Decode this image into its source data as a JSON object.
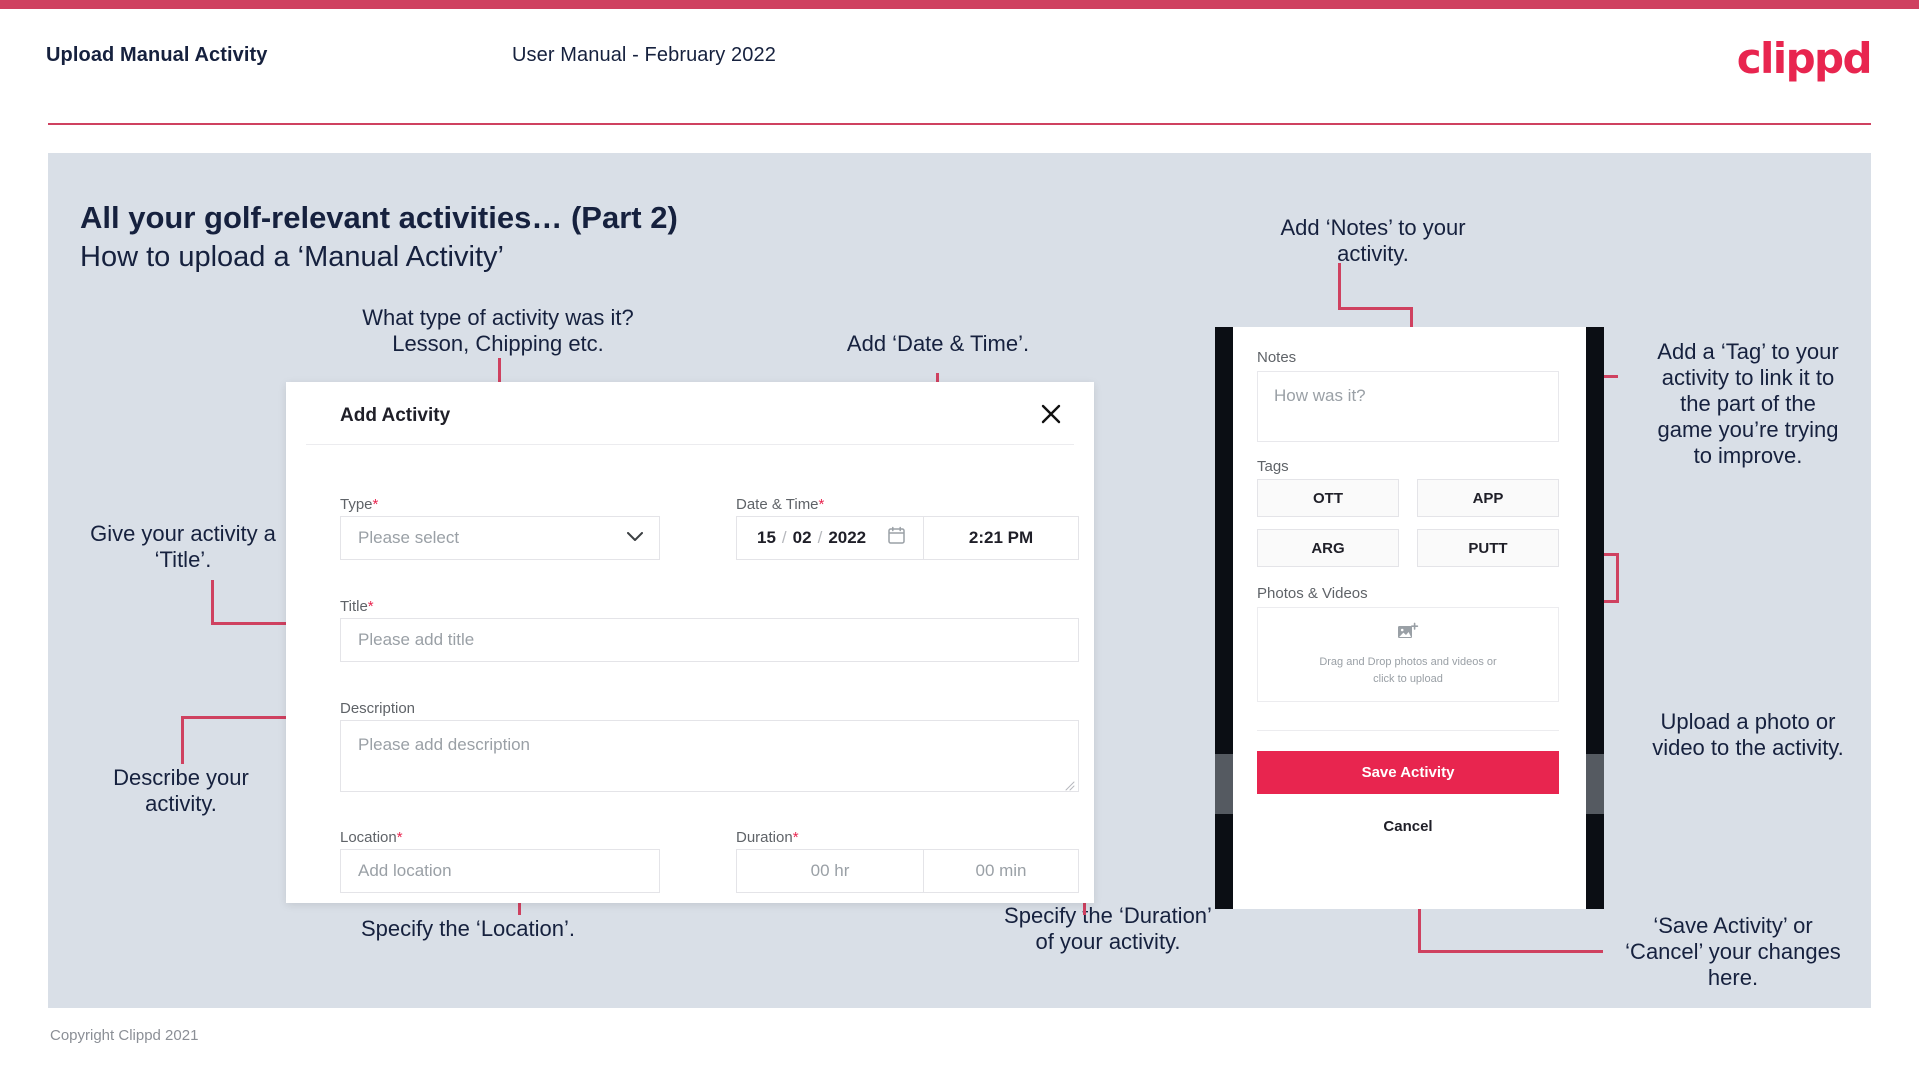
{
  "header": {
    "title": "Upload Manual Activity",
    "subtitle": "User Manual - February 2022",
    "logo": "clippd"
  },
  "slide": {
    "title": "All your golf-relevant activities… (Part 2)",
    "subtitle": "How to upload a ‘Manual Activity’"
  },
  "callouts": {
    "type": "What type of activity was it?\nLesson, Chipping etc.",
    "datetime": "Add ‘Date & Time’.",
    "title": "Give your activity a\n‘Title’.",
    "description": "Describe your\nactivity.",
    "location": "Specify the ‘Location’.",
    "duration": "Specify the ‘Duration’\nof your activity.",
    "notes": "Add ‘Notes’ to your\nactivity.",
    "tags": "Add a ‘Tag’ to your\nactivity to link it to\nthe part of the\ngame you’re trying\nto improve.",
    "upload": "Upload a photo or\nvideo to the activity.",
    "save": "‘Save Activity’ or\n‘Cancel’ your changes\nhere."
  },
  "dialog": {
    "title": "Add Activity",
    "close_icon": "close-icon",
    "type": {
      "label": "Type",
      "required": "*",
      "placeholder": "Please select"
    },
    "datetime": {
      "label": "Date & Time",
      "required": "*",
      "day": "15",
      "month": "02",
      "year": "2022",
      "separator": "/",
      "time": "2:21 PM"
    },
    "activity_title": {
      "label": "Title",
      "required": "*",
      "placeholder": "Please add title"
    },
    "description": {
      "label": "Description",
      "placeholder": "Please add description"
    },
    "location": {
      "label": "Location",
      "required": "*",
      "placeholder": "Add location"
    },
    "duration": {
      "label": "Duration",
      "required": "*",
      "hours_placeholder": "00 hr",
      "minutes_placeholder": "00 min"
    }
  },
  "phone": {
    "notes": {
      "label": "Notes",
      "placeholder": "How was it?"
    },
    "tags": {
      "label": "Tags",
      "options": [
        "OTT",
        "APP",
        "ARG",
        "PUTT"
      ]
    },
    "photos": {
      "label": "Photos & Videos",
      "dropzone_text": "Drag and Drop photos and videos or\nclick to upload",
      "dropzone_icon": "add-image-icon"
    },
    "save_label": "Save Activity",
    "cancel_label": "Cancel"
  },
  "footer": {
    "copyright": "Copyright Clippd 2021"
  },
  "colors": {
    "accent": "#e8254f",
    "rule": "#cf4160",
    "slide_bg": "#d9dfe7",
    "title": "#16213e"
  }
}
